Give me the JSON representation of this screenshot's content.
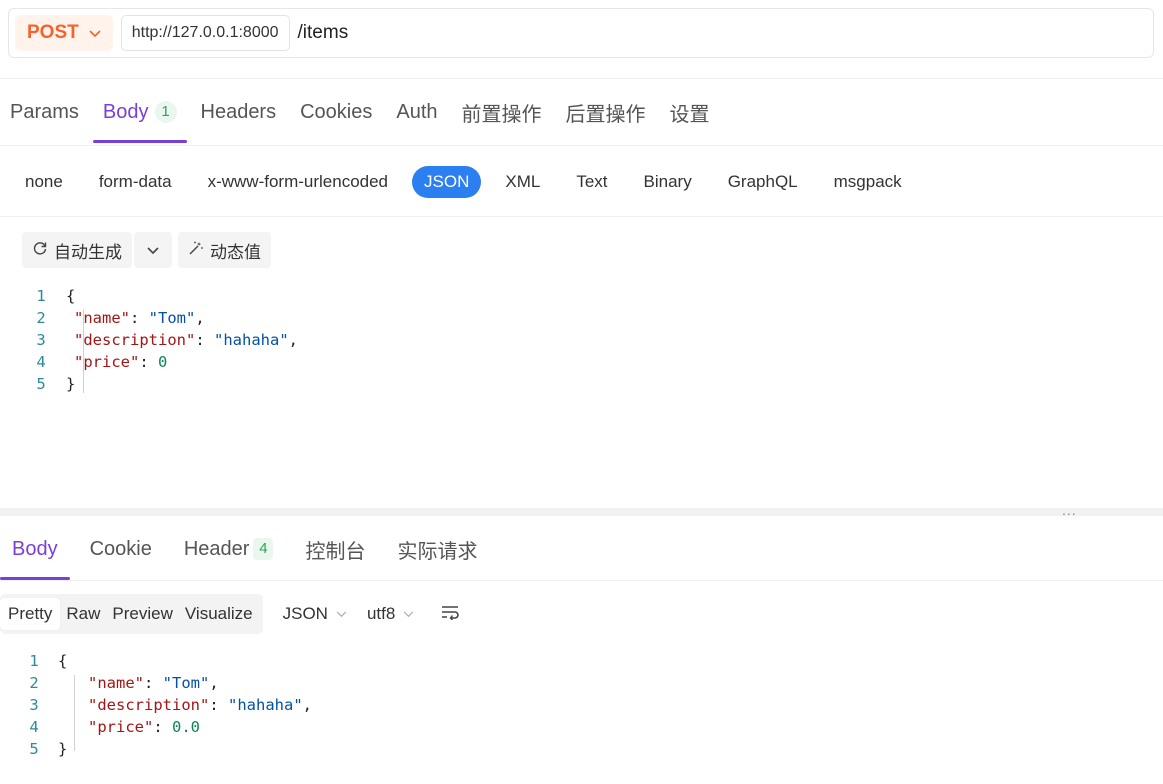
{
  "request": {
    "method": "POST",
    "host": "http://127.0.0.1:8000",
    "path": "/items"
  },
  "req_tabs": [
    {
      "label": "Params"
    },
    {
      "label": "Body",
      "badge": "1",
      "active": true
    },
    {
      "label": "Headers"
    },
    {
      "label": "Cookies"
    },
    {
      "label": "Auth"
    },
    {
      "label": "前置操作"
    },
    {
      "label": "后置操作"
    },
    {
      "label": "设置"
    }
  ],
  "body_types": [
    "none",
    "form-data",
    "x-www-form-urlencoded",
    "JSON",
    "XML",
    "Text",
    "Binary",
    "GraphQL",
    "msgpack"
  ],
  "body_type_selected": "JSON",
  "toolbar": {
    "auto_generate": "自动生成",
    "dynamic_value": "动态值"
  },
  "request_body_lines": [
    {
      "n": "1",
      "text": "{"
    },
    {
      "n": "2",
      "key": "\"name\"",
      "value": "\"Tom\"",
      "vtype": "str",
      "comma": ","
    },
    {
      "n": "3",
      "key": "\"description\"",
      "value": "\"hahaha\"",
      "vtype": "str",
      "comma": ","
    },
    {
      "n": "4",
      "key": "\"price\"",
      "value": "0",
      "vtype": "num",
      "comma": ""
    },
    {
      "n": "5",
      "text": "}"
    }
  ],
  "splitter_dots": "...",
  "resp_tabs": [
    {
      "label": "Body",
      "active": true
    },
    {
      "label": "Cookie"
    },
    {
      "label": "Header",
      "badge": "4"
    },
    {
      "label": "控制台"
    },
    {
      "label": "实际请求"
    }
  ],
  "view_modes": [
    "Pretty",
    "Raw",
    "Preview",
    "Visualize"
  ],
  "view_mode_selected": "Pretty",
  "format_select": "JSON",
  "encoding_select": "utf8",
  "response_body_lines": [
    {
      "n": "1",
      "text": "{"
    },
    {
      "n": "2",
      "key": "\"name\"",
      "value": "\"Tom\"",
      "vtype": "str",
      "comma": ","
    },
    {
      "n": "3",
      "key": "\"description\"",
      "value": "\"hahaha\"",
      "vtype": "str",
      "comma": ","
    },
    {
      "n": "4",
      "key": "\"price\"",
      "value": "0.0",
      "vtype": "num",
      "comma": ""
    },
    {
      "n": "5",
      "text": "}"
    }
  ],
  "colors": {
    "method": "#f4632c",
    "accent": "#7a3fd6",
    "selected_pill": "#2b7ff0",
    "badge_green": "#2fa35a"
  }
}
